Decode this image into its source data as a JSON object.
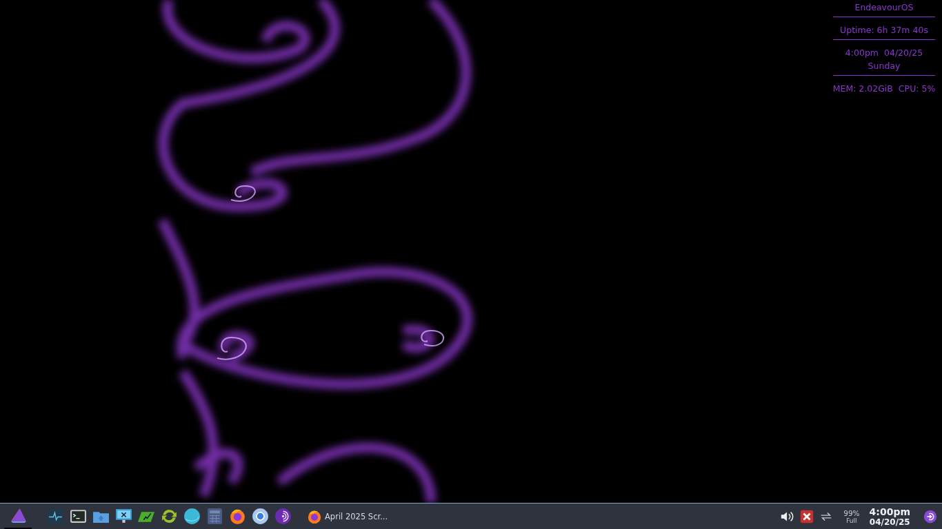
{
  "conky": {
    "sections": [
      {
        "lines": [
          "EndeavourOS"
        ]
      },
      {
        "lines": [
          "Uptime: 6h 37m 40s"
        ]
      },
      {
        "lines": [
          "4:00pm  04/20/25",
          "Sunday"
        ]
      },
      {
        "lines": [
          "MEM: 2.02GiB  CPU: 5%"
        ]
      }
    ]
  },
  "taskbar": {
    "launchers": [
      {
        "kind": "monitor"
      },
      {
        "kind": "terminal"
      },
      {
        "kind": "folder"
      },
      {
        "kind": "remote"
      },
      {
        "kind": "editor"
      },
      {
        "kind": "update"
      },
      {
        "kind": "sphere"
      },
      {
        "kind": "calculator"
      },
      {
        "kind": "firefox"
      },
      {
        "kind": "chromium"
      },
      {
        "kind": "tor"
      }
    ],
    "tasks": [
      {
        "kind": "firefox",
        "title": "April 2025 Scr..."
      }
    ],
    "battery": {
      "percent": "99%",
      "status": "Full"
    },
    "clock": {
      "time": "4:00pm",
      "date": "04/20/25"
    }
  }
}
